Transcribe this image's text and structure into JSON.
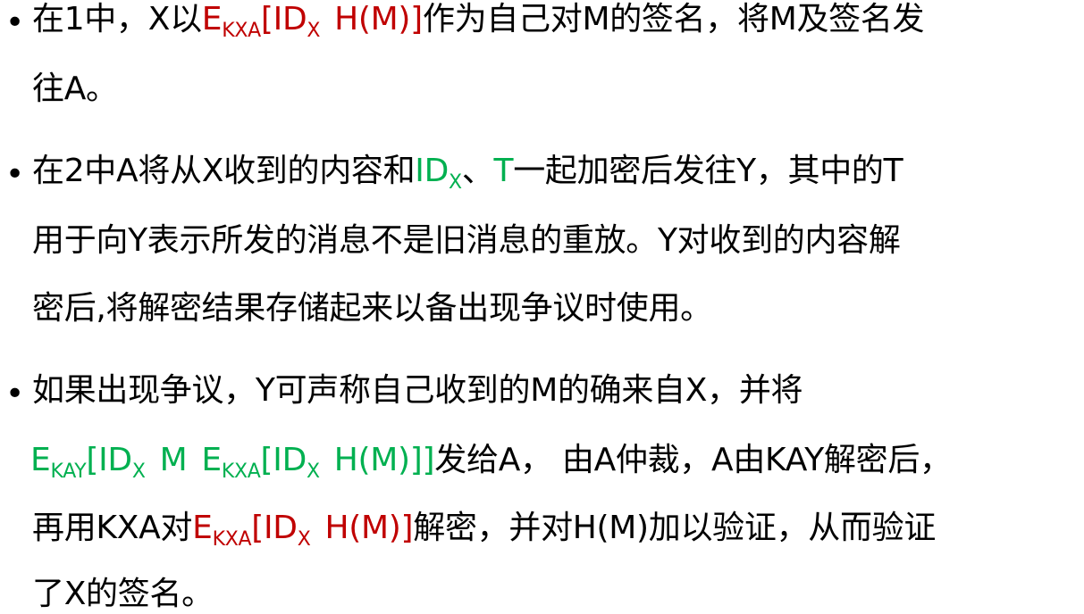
{
  "colors": {
    "text": "#000000",
    "red": "#c00000",
    "green": "#00b050"
  },
  "bullet_symbol": "•",
  "b1": {
    "l1_a": "在1中，X以",
    "l1_E": "E",
    "l1_Esub": "KXA",
    "l1_id": "[ID",
    "l1_idsub": "X",
    "l1_hm": "H(M)]",
    "l1_b": "作为自己对M的签名，将M及签名发",
    "l2": "往A。"
  },
  "b2": {
    "l1_a": "在2中A将从X收到的内容和",
    "l1_id": "ID",
    "l1_idsub": "X",
    "l1_sep": "、",
    "l1_t": "T",
    "l1_b": "一起加密后发往Y，其中的T",
    "l2": "用于向Y表示所发的消息不是旧消息的重放。Y对收到的内容解",
    "l3": "密后,将解密结果存储起来以备出现争议时使用。"
  },
  "b3": {
    "l1": "如果出现争议，Y可声称自己收到的M的确来自X，并将",
    "l2_E": "E",
    "l2_Esub": "KAY",
    "l2_id": "[ID",
    "l2_idsub": "X",
    "l2_m": "M",
    "l2_E2": "E",
    "l2_E2sub": "KXA",
    "l2_id2": "[ID",
    "l2_id2sub": "X",
    "l2_hm": "H(M)]]",
    "l2_b": "发给A， 由A仲裁，A由KAY解密后，",
    "l3_a": "再用KXA对",
    "l3_E": "E",
    "l3_Esub": "KXA",
    "l3_id": "[ID",
    "l3_idsub": "X",
    "l3_hm": "H(M)]",
    "l3_b": "解密，并对H(M)加以验证，从而验证",
    "l4": "了X的签名。"
  }
}
